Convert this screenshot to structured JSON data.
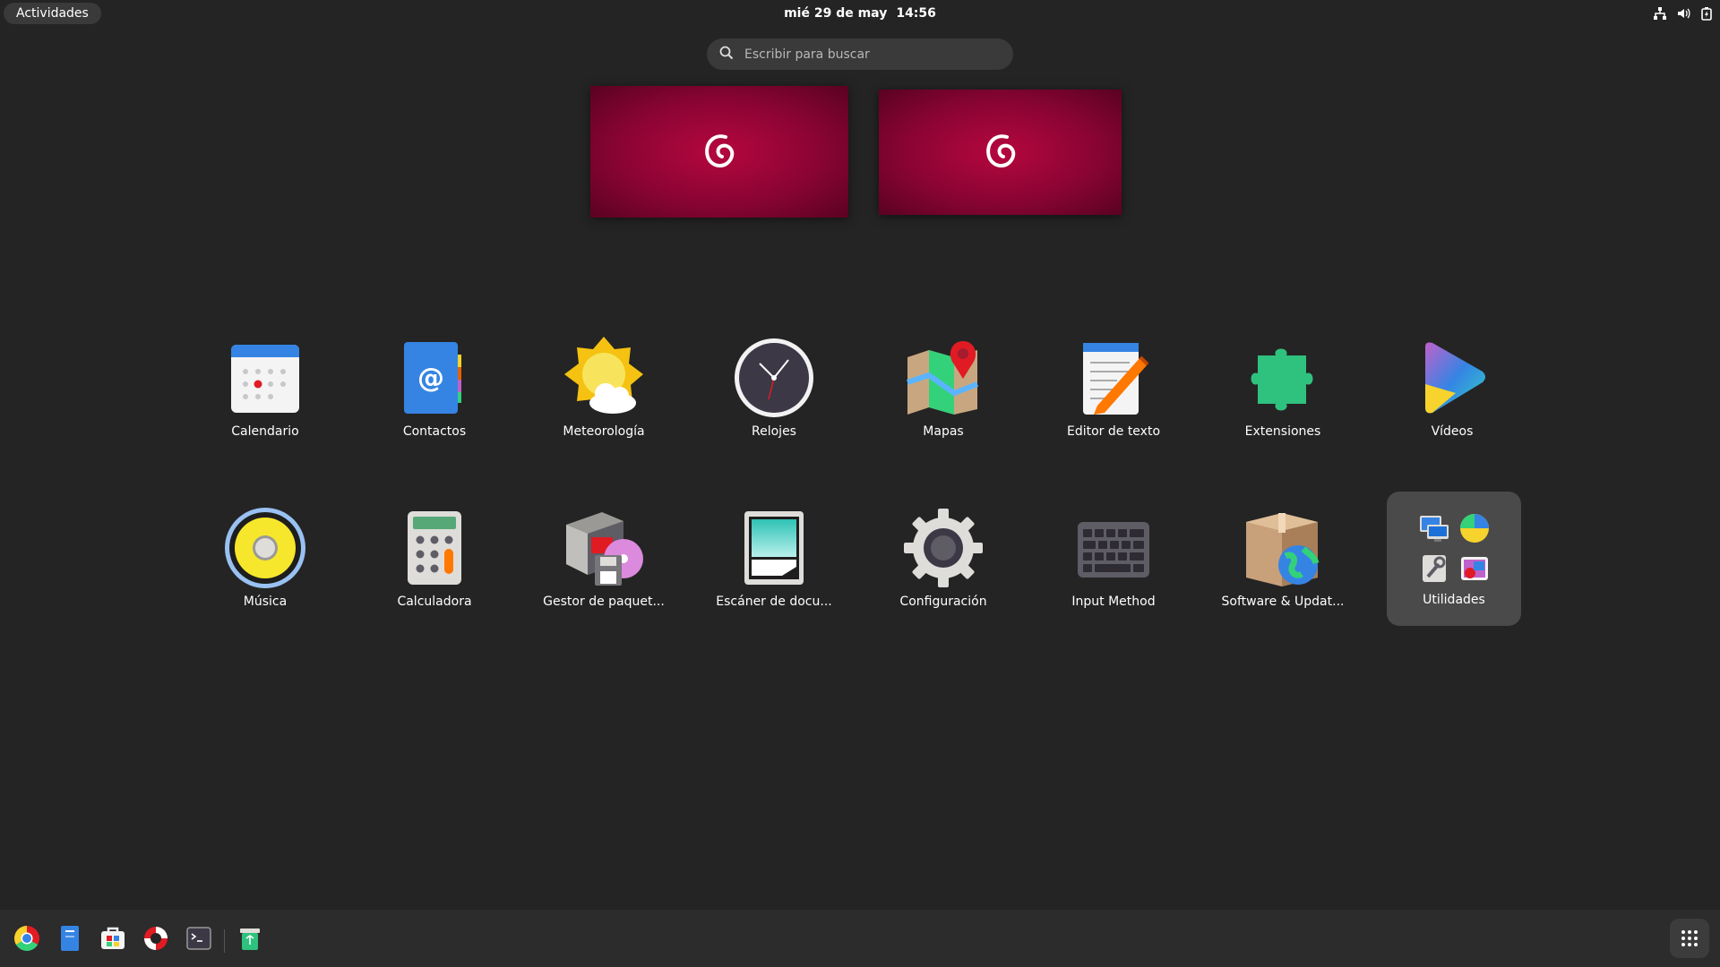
{
  "topbar": {
    "activities_label": "Actividades",
    "date": "mié 29 de may",
    "time": "14:56",
    "tray_icons": [
      "network-icon",
      "volume-icon",
      "battery-icon"
    ]
  },
  "search": {
    "placeholder": "Escribir para buscar",
    "icon": "search-icon"
  },
  "workspaces": [
    {
      "logo": "debian-swirl-icon"
    },
    {
      "logo": "debian-swirl-icon"
    }
  ],
  "apps": {
    "row1": [
      {
        "label": "Calendario",
        "icon": "calendar-icon"
      },
      {
        "label": "Contactos",
        "icon": "contacts-icon"
      },
      {
        "label": "Meteorología",
        "icon": "weather-icon"
      },
      {
        "label": "Relojes",
        "icon": "clock-icon"
      },
      {
        "label": "Mapas",
        "icon": "maps-icon"
      },
      {
        "label": "Editor de texto",
        "icon": "text-editor-icon"
      },
      {
        "label": "Extensiones",
        "icon": "extensions-icon"
      },
      {
        "label": "Vídeos",
        "icon": "videos-icon"
      }
    ],
    "row2": [
      {
        "label": "Música",
        "icon": "music-icon"
      },
      {
        "label": "Calculadora",
        "icon": "calculator-icon"
      },
      {
        "label": "Gestor de paquet...",
        "icon": "package-manager-icon"
      },
      {
        "label": "Escáner de docu...",
        "icon": "document-scanner-icon"
      },
      {
        "label": "Configuración",
        "icon": "settings-icon"
      },
      {
        "label": "Input Method",
        "icon": "keyboard-icon"
      },
      {
        "label": "Software & Updat...",
        "icon": "software-updates-icon"
      }
    ],
    "folder": {
      "label": "Utilidades",
      "icons": [
        "remote-desktop-icon",
        "disk-usage-icon",
        "system-tools-icon",
        "photos-icon"
      ]
    }
  },
  "dash": {
    "items": [
      "chrome-icon",
      "files-icon",
      "software-store-icon",
      "help-icon",
      "terminal-icon",
      "trash-icon"
    ],
    "show_apps": "show-apps-icon"
  },
  "colors": {
    "background": "#242424",
    "workspace": "#9c0538",
    "dash": "#2c2c2c"
  }
}
